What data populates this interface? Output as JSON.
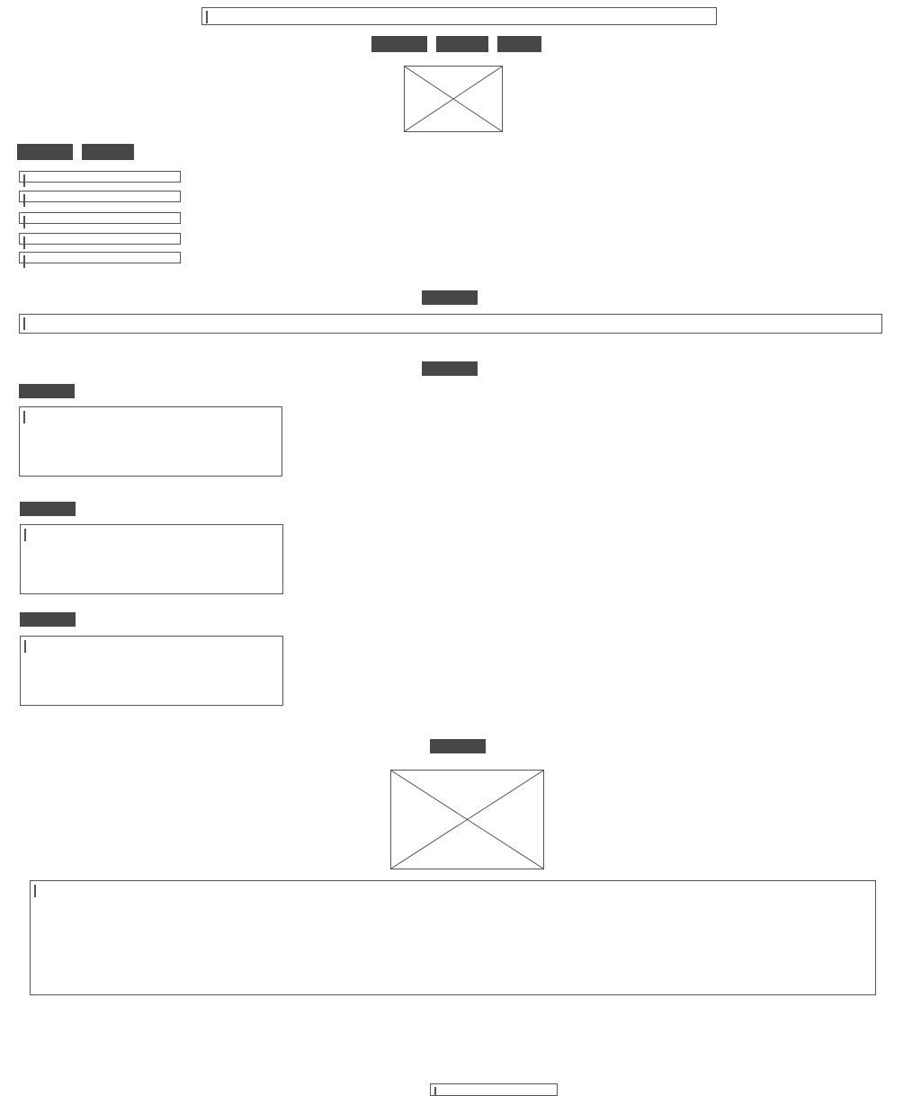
{
  "header": {
    "title_field": {
      "value": "",
      "placeholder": ""
    },
    "nav": [
      {
        "label": ""
      },
      {
        "label": ""
      },
      {
        "label": ""
      }
    ],
    "logo_icon": "image-placeholder-icon"
  },
  "form": {
    "actions": [
      {
        "label": ""
      },
      {
        "label": ""
      }
    ],
    "fields": [
      {
        "value": "",
        "placeholder": ""
      },
      {
        "value": "",
        "placeholder": ""
      },
      {
        "value": "",
        "placeholder": ""
      },
      {
        "value": "",
        "placeholder": ""
      },
      {
        "value": "",
        "placeholder": ""
      }
    ]
  },
  "search": {
    "heading": "",
    "input": {
      "value": "",
      "placeholder": ""
    }
  },
  "notes": {
    "heading": "",
    "groups": [
      {
        "label": "",
        "text": ""
      },
      {
        "label": "",
        "text": ""
      },
      {
        "label": "",
        "text": ""
      }
    ]
  },
  "media": {
    "heading": "",
    "image_icon": "image-placeholder-icon",
    "description": {
      "value": "",
      "placeholder": ""
    }
  },
  "footer": {
    "input": {
      "value": "",
      "placeholder": ""
    }
  },
  "colors": {
    "bar": "#474747",
    "border": "#555555",
    "background": "#ffffff"
  }
}
